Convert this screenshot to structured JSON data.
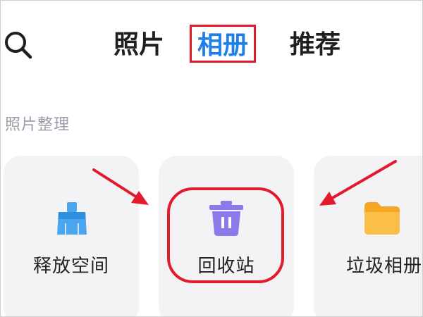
{
  "topbar": {
    "search_icon": "search-icon",
    "tabs": [
      {
        "label": "照片"
      },
      {
        "label": "相册"
      },
      {
        "label": "推荐"
      }
    ],
    "active_color": "#1f7fe8",
    "highlight_color": "#e21a2c"
  },
  "section": {
    "title": "照片整理"
  },
  "cards": [
    {
      "label": "释放空间",
      "icon": "broom-icon",
      "color": "#4aa6ef"
    },
    {
      "label": "回收站",
      "icon": "trash-icon",
      "color": "#8c79ea"
    },
    {
      "label": "垃圾相册",
      "icon": "folder-icon",
      "color": "#f7b63a"
    }
  ]
}
